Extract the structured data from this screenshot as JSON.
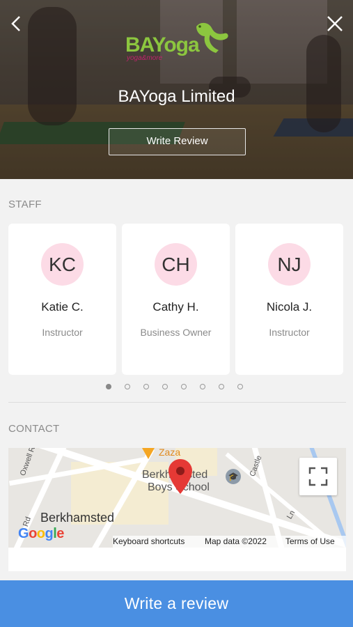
{
  "header": {
    "back_icon": "chevron-left-icon",
    "close_icon": "close-icon",
    "logo_text": "BAYoga",
    "logo_subtext": "yoga&more",
    "business_name": "BAYoga Limited",
    "write_review_label": "Write Review"
  },
  "staff": {
    "section_title": "STAFF",
    "members": [
      {
        "initials": "KC",
        "name": "Katie C.",
        "role": "Instructor"
      },
      {
        "initials": "CH",
        "name": "Cathy H.",
        "role": "Business Owner"
      },
      {
        "initials": "NJ",
        "name": "Nicola J.",
        "role": "Instructor"
      }
    ],
    "pagination": {
      "total": 8,
      "active": 0
    }
  },
  "contact": {
    "section_title": "CONTACT",
    "map": {
      "labels": {
        "zaza": "Zaza",
        "school_line1": "Berkhamsted",
        "school_line2": "Boys School",
        "town": "Berkhamsted",
        "castle": "Castle",
        "oxwell": "Oxwell Rd",
        "rd": "Rd",
        "ln": "Ln"
      },
      "google_logo": "Google",
      "footer": {
        "shortcuts": "Keyboard shortcuts",
        "map_data": "Map data ©2022",
        "terms": "Terms of Use"
      }
    }
  },
  "bottom_button": {
    "label": "Write a review"
  },
  "colors": {
    "accent": "#4a8fe2",
    "avatar_bg": "#fcdbe6",
    "logo_green": "#8cc63f",
    "logo_pink": "#c0246d",
    "pin_red": "#e53935"
  }
}
